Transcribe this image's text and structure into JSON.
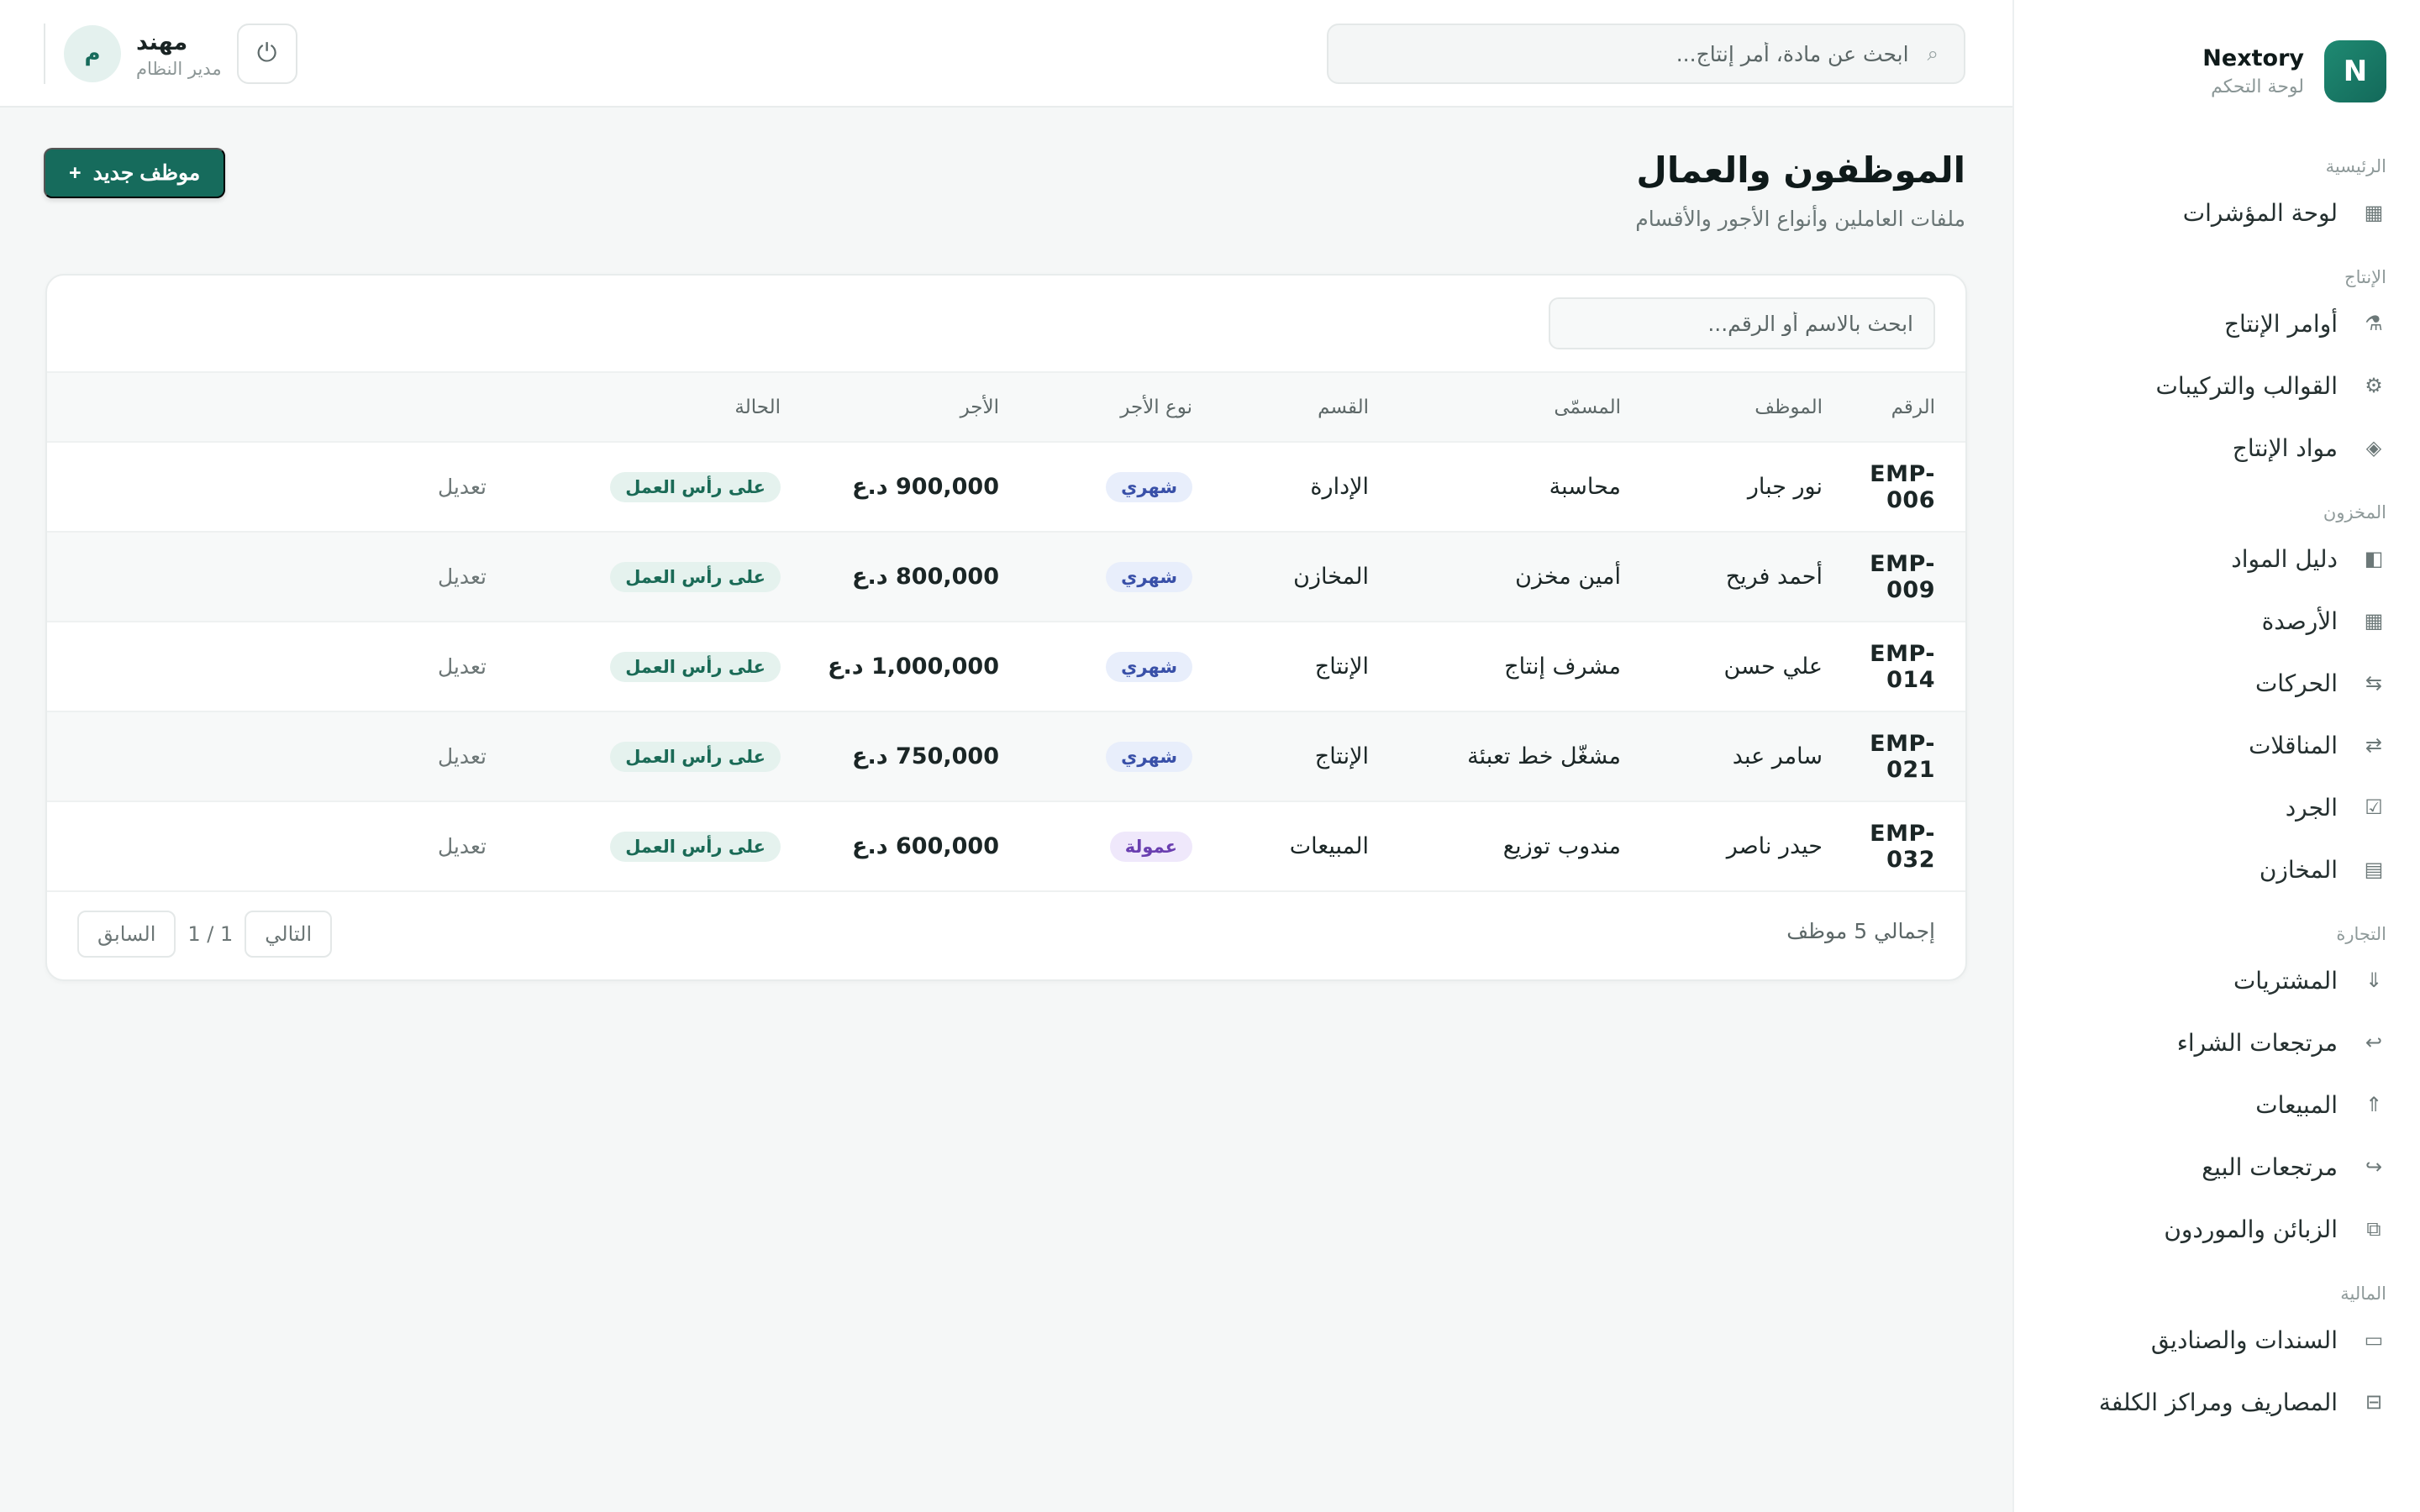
{
  "brand": {
    "logo_letter": "N",
    "name": "Nextory",
    "subtitle": "لوحة التحكم"
  },
  "sidebar": {
    "sections": [
      {
        "heading": "الرئيسية",
        "items": [
          {
            "label": "لوحة المؤشرات",
            "icon": "▦"
          }
        ]
      },
      {
        "heading": "الإنتاج",
        "items": [
          {
            "label": "أوامر الإنتاج",
            "icon": "⚗"
          },
          {
            "label": "القوالب والتركيبات",
            "icon": "⚙"
          },
          {
            "label": "مواد الإنتاج",
            "icon": "◈"
          }
        ]
      },
      {
        "heading": "المخزون",
        "items": [
          {
            "label": "دليل المواد",
            "icon": "◧"
          },
          {
            "label": "الأرصدة",
            "icon": "▦"
          },
          {
            "label": "الحركات",
            "icon": "⇆"
          },
          {
            "label": "المناقلات",
            "icon": "⇄"
          },
          {
            "label": "الجرد",
            "icon": "☑"
          },
          {
            "label": "المخازن",
            "icon": "▤"
          }
        ]
      },
      {
        "heading": "التجارة",
        "items": [
          {
            "label": "المشتريات",
            "icon": "⇓"
          },
          {
            "label": "مرتجعات الشراء",
            "icon": "↩"
          },
          {
            "label": "المبيعات",
            "icon": "⇑"
          },
          {
            "label": "مرتجعات البيع",
            "icon": "↪"
          },
          {
            "label": "الزبائن والموردون",
            "icon": "⧉"
          }
        ]
      },
      {
        "heading": "المالية",
        "items": [
          {
            "label": "السندات والصناديق",
            "icon": "▭"
          },
          {
            "label": "المصاريف ومراكز الكلفة",
            "icon": "⊟"
          }
        ]
      }
    ]
  },
  "topbar": {
    "search_placeholder": "ابحث عن مادة، أمر إنتاج...",
    "user": {
      "avatar_letter": "م",
      "name": "مهند",
      "role": "مدير النظام"
    }
  },
  "page": {
    "title": "الموظفون والعمال",
    "subtitle": "ملفات العاملين وأنواع الأجور والأقسام",
    "new_button": "موظف جديد",
    "new_button_icon": "+"
  },
  "table": {
    "search_placeholder": "ابحث بالاسم أو الرقم...",
    "columns": [
      "الرقم",
      "الموظف",
      "المسمّى",
      "القسم",
      "نوع الأجر",
      "الأجر",
      "الحالة",
      ""
    ],
    "rows": [
      {
        "code": "EMP-006",
        "name": "نور جبار",
        "title": "محاسبة",
        "dept": "الإدارة",
        "wage_type": "شهري",
        "wage_kind": "monthly",
        "wage": "900,000 د.ع",
        "status": "على رأس العمل",
        "action": "تعديل"
      },
      {
        "code": "EMP-009",
        "name": "أحمد فريح",
        "title": "أمين مخزن",
        "dept": "المخازن",
        "wage_type": "شهري",
        "wage_kind": "monthly",
        "wage": "800,000 د.ع",
        "status": "على رأس العمل",
        "action": "تعديل"
      },
      {
        "code": "EMP-014",
        "name": "علي حسن",
        "title": "مشرف إنتاج",
        "dept": "الإنتاج",
        "wage_type": "شهري",
        "wage_kind": "monthly",
        "wage": "1,000,000 د.ع",
        "status": "على رأس العمل",
        "action": "تعديل"
      },
      {
        "code": "EMP-021",
        "name": "سامر عبد",
        "title": "مشغّل خط تعبئة",
        "dept": "الإنتاج",
        "wage_type": "شهري",
        "wage_kind": "monthly",
        "wage": "750,000 د.ع",
        "status": "على رأس العمل",
        "action": "تعديل"
      },
      {
        "code": "EMP-032",
        "name": "حيدر ناصر",
        "title": "مندوب توزيع",
        "dept": "المبيعات",
        "wage_type": "عمولة",
        "wage_kind": "commission",
        "wage": "600,000 د.ع",
        "status": "على رأس العمل",
        "action": "تعديل"
      }
    ],
    "total_label": "إجمالي 5 موظف",
    "pagination": {
      "prev": "السابق",
      "info": "1 / 1",
      "next": "التالي"
    }
  },
  "colors": {
    "accent": "#166b5c",
    "monthly_pill": "#e8eefb",
    "commission_pill": "#efe8fb",
    "status_pill": "#e5f2ee"
  }
}
